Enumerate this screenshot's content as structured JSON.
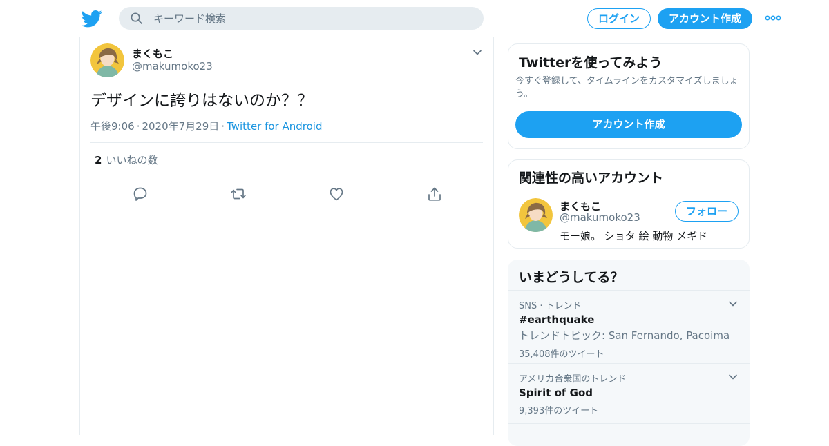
{
  "colors": {
    "brand": "#1da1f2",
    "muted": "#657786",
    "border": "#e6ecf0"
  },
  "header": {
    "logo_icon": "twitter-bird-icon",
    "search_placeholder": "キーワード検索",
    "login_label": "ログイン",
    "signup_label": "アカウント作成",
    "more_icon": "more-dots-icon"
  },
  "tweet": {
    "name": "まくもこ",
    "handle": "@makumoko23",
    "text": "デザインに誇りはないのか？？",
    "time": "午後9:06",
    "date": "2020年7月29日",
    "source": "Twitter for Android",
    "likes_count": "2",
    "likes_label": "いいねの数"
  },
  "signup_card": {
    "title": "Twitterを使ってみよう",
    "description": "今すぐ登録して、タイムラインをカスタマイズしましょう。",
    "button_label": "アカウント作成"
  },
  "related_card": {
    "title": "関連性の高いアカウント",
    "name": "まくもこ",
    "handle": "@makumoko23",
    "bio": "モー娘。 ショタ 絵 動物 メギド",
    "follow_label": "フォロー"
  },
  "trends_card": {
    "title": "いまどうしてる？",
    "items": [
      {
        "context": "SNS · トレンド",
        "name": "#earthquake",
        "desc": "トレンドトピック: San Fernando, Pacoima",
        "count": "35,408件のツイート"
      },
      {
        "context": "アメリカ合衆国のトレンド",
        "name": "Spirit of God",
        "desc": "",
        "count": "9,393件のツイート"
      }
    ]
  }
}
